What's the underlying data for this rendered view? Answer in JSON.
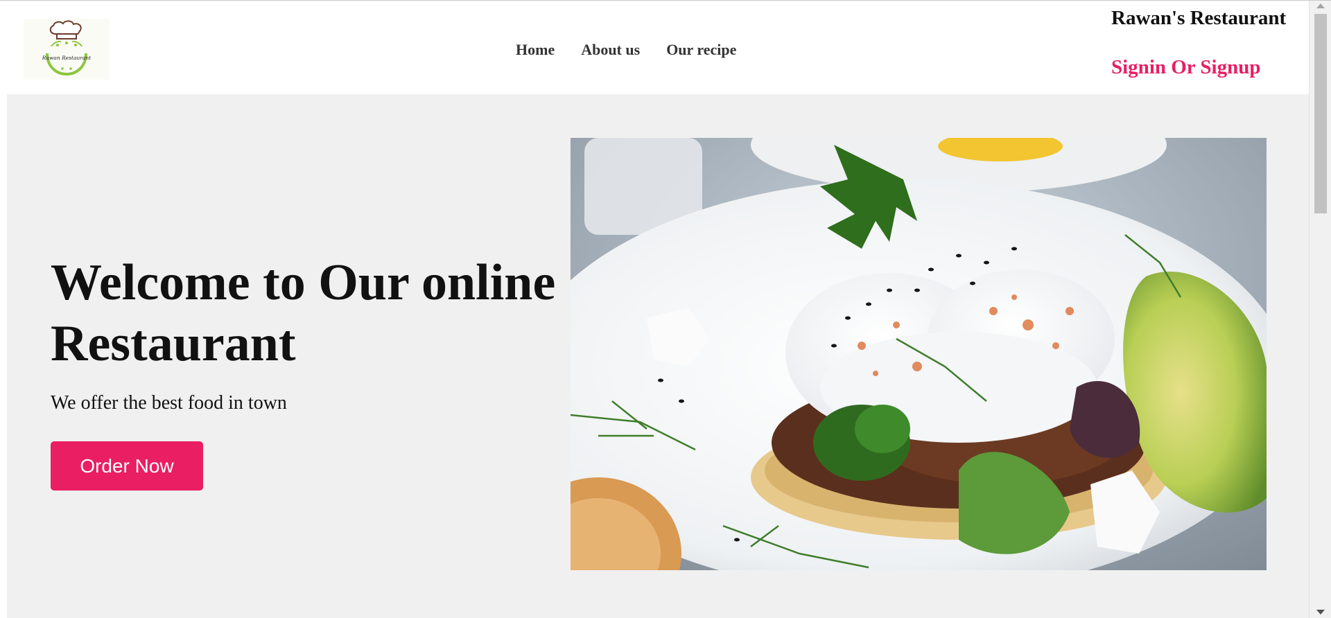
{
  "header": {
    "logo_text": "Rawan Restaurant",
    "nav": [
      "Home",
      "About us",
      "Our recipe"
    ],
    "brand": "Rawan's Restaurant",
    "signin": "Signin Or Signup"
  },
  "hero": {
    "title": "Welcome to Our online Restaurant",
    "subtitle": "We offer the best food in town",
    "cta": "Order Now",
    "image_subject": "poached eggs with greens, feta and avocado on a white plate"
  },
  "colors": {
    "accent": "#e91e63",
    "page_bg": "#f0f0f0",
    "header_bg": "#ffffff",
    "text": "#111111"
  },
  "icons": [
    "chef-hat-logo-icon",
    "scroll-up-arrow-icon",
    "scroll-down-arrow-icon"
  ]
}
